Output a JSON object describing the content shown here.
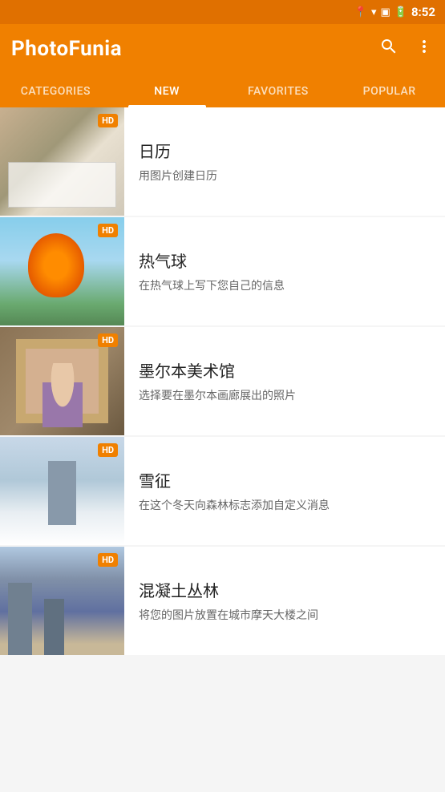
{
  "statusBar": {
    "time": "8:52",
    "icons": [
      "location",
      "wifi",
      "sim",
      "battery"
    ]
  },
  "header": {
    "logo": "PhotoFunia",
    "logoPhoto": "Photo",
    "logoFunia": "Funia",
    "searchLabel": "search",
    "menuLabel": "more options"
  },
  "tabs": [
    {
      "id": "categories",
      "label": "CATEGORIES",
      "active": false
    },
    {
      "id": "new",
      "label": "NEW",
      "active": true
    },
    {
      "id": "favorites",
      "label": "FAVORITES",
      "active": false
    },
    {
      "id": "popular",
      "label": "POPULAR",
      "active": false
    }
  ],
  "items": [
    {
      "id": "calendar",
      "title": "日历",
      "description": "用图片创建日历",
      "hd": true,
      "imageType": "calendar"
    },
    {
      "id": "balloon",
      "title": "热气球",
      "description": "在热气球上写下您自己的信息",
      "hd": true,
      "imageType": "balloon"
    },
    {
      "id": "museum",
      "title": "墨尔本美术馆",
      "description": "选择要在墨尔本画廊展出的照片",
      "hd": true,
      "imageType": "museum"
    },
    {
      "id": "snow",
      "title": "雪征",
      "description": "在这个冬天向森林标志添加自定义消息",
      "hd": true,
      "imageType": "snow"
    },
    {
      "id": "city",
      "title": "混凝土丛林",
      "description": "将您的图片放置在城市摩天大楼之间",
      "hd": true,
      "imageType": "city"
    }
  ],
  "hdBadge": "HD"
}
